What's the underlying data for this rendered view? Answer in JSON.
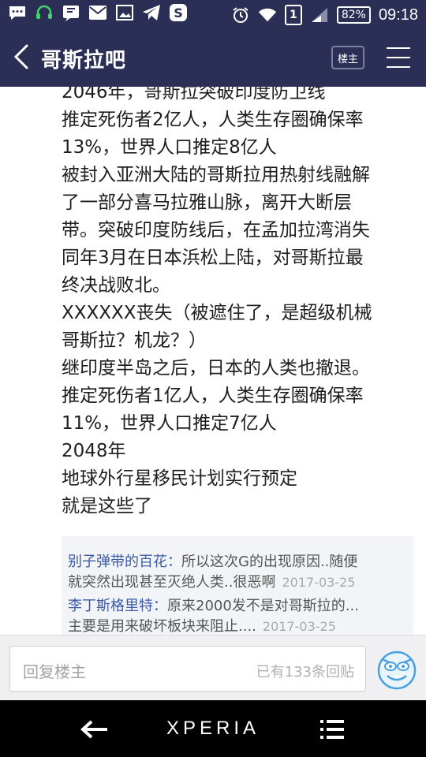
{
  "status_bar": {
    "sim_label": "1",
    "battery": "82%",
    "time": "09:18",
    "icons": [
      "chat-bubble-icon",
      "headset-icon",
      "qq-icon",
      "mail-icon",
      "image-icon",
      "telegram-icon",
      "s-app-icon",
      "alarm-icon",
      "wifi-icon",
      "signal-icon"
    ]
  },
  "header": {
    "title": "哥斯拉吧",
    "louzhu_label": "楼主"
  },
  "post": {
    "lines": [
      "2046年，哥斯拉突破印度防卫线",
      "推定死伤者2亿人，人类生存圈确保率",
      "13%，世界人口推定8亿人",
      "被封入亚洲大陆的哥斯拉用热射线融解",
      "了一部分喜马拉雅山脉，离开大断层",
      "带。突破印度防线后，在孟加拉湾消失",
      "同年3月在日本浜松上陆，对哥斯拉最",
      "终决战败北。",
      "XXXXXX丧失（被遮住了，是超级机械",
      "哥斯拉？机龙？）",
      "继印度半岛之后，日本的人类也撤退。",
      "推定死伤者1亿人，人类生存圈确保率",
      "11%，世界人口推定7亿人",
      "2048年",
      "地球外行星移民计划实行预定",
      "就是这些了"
    ]
  },
  "replies": [
    {
      "name": "别子弹带的百花：",
      "text1": "所以这次G的出现原因..随便",
      "text2": "就突然出现甚至灭绝人类..很恶啊",
      "date": "2017-03-25"
    },
    {
      "name": "李丁斯格里特：",
      "text1": "原来2000发不是对哥斯拉的...",
      "text2": "主要是用来破坏板块来阻止....",
      "date": "2017-03-25"
    }
  ],
  "reply_bar": {
    "placeholder": "回复楼主",
    "count": "已有133条回贴"
  },
  "nav_bar": {
    "brand": "XPERIA"
  },
  "colors": {
    "header_bg": "#2b2f56",
    "reply_name": "#3a5aa8",
    "date": "#a9a9a9"
  }
}
